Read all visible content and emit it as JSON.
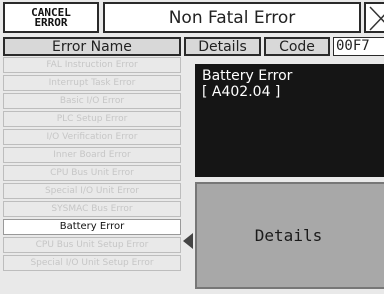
{
  "header": {
    "cancel_line1": "CANCEL",
    "cancel_line2": "ERROR",
    "title": "Non Fatal Error",
    "col_error_name": "Error Name",
    "col_details": "Details",
    "col_code": "Code",
    "code_value": "00F7"
  },
  "errors": [
    "FAL Instruction Error",
    "Interrupt Task Error",
    "Basic I/O Error",
    "PLC Setup Error",
    "I/O Verification Error",
    "Inner Board Error",
    "CPU Bus Unit Error",
    "Special I/O Unit Error",
    "SYSMAC Bus Error",
    "Battery Error",
    "CPU Bus Unit Setup Error",
    "Special I/O Unit Setup Error"
  ],
  "selected_index": 9,
  "detail": {
    "name": "Battery Error",
    "code": "[ A402.04 ]",
    "button_label": "Details"
  },
  "colors": {
    "selected_bg": "#ffffff",
    "disabled_text": "#c6c6c6",
    "panel_bg": "#151515",
    "button_bg": "#a8a8a8"
  },
  "icons": {
    "close": "close-icon",
    "selection": "selection-arrow-icon"
  }
}
